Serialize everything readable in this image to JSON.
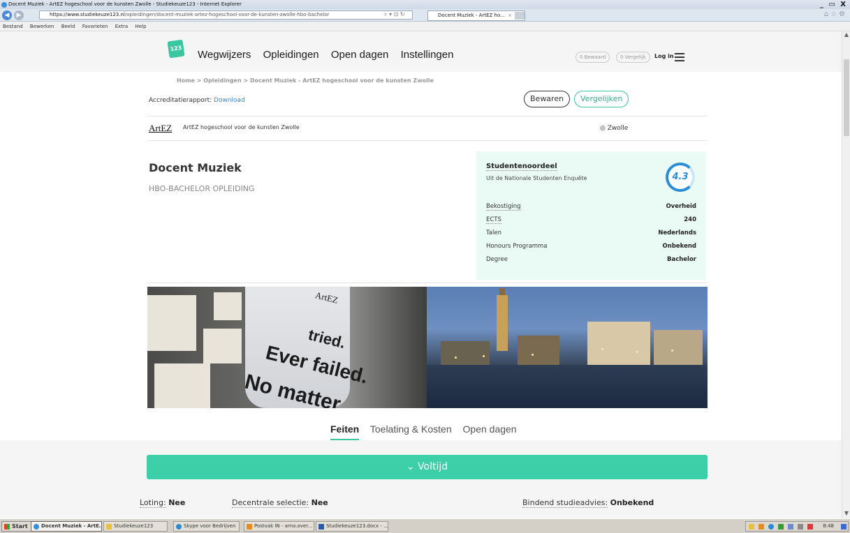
{
  "window": {
    "title": "Docent Muziek - ArtEZ hogeschool voor de kunsten Zwolle - Studiekeuze123 - Internet Explorer",
    "controls": "_ ▭ X"
  },
  "browser": {
    "url_host": "https://www.studiekeuze123.nl",
    "url_path": "/opleidingen/docent-muziek-artez-hogeschool-voor-de-kunsten-zwolle-hbo-bachelor",
    "tab_label": "Docent Muziek - ArtEZ ho...",
    "menu": [
      "Bestand",
      "Bewerken",
      "Beeld",
      "Favorieten",
      "Extra",
      "Help"
    ]
  },
  "site": {
    "logo_text": "123",
    "nav": [
      "Wegwijzers",
      "Opleidingen",
      "Open dagen",
      "Instellingen"
    ],
    "saved_pill": "0 Bewaard",
    "compare_pill": "0 Vergelijk",
    "login": "Log in"
  },
  "breadcrumb": "Home > Opleidingen > Docent Muziek - ArtEZ hogeschool voor de kunsten Zwolle",
  "accreditation": {
    "label": "Accreditatierapport:",
    "link": "Download"
  },
  "actions": {
    "save": "Bewaren",
    "compare": "Vergelijken"
  },
  "institution": {
    "logo": "ArtEZ",
    "name": "ArtEZ hogeschool voor de kunsten Zwolle",
    "location": "Zwolle"
  },
  "program": {
    "title": "Docent Muziek",
    "subtitle": "HBO-BACHELOR OPLEIDING"
  },
  "facts": {
    "rating_title": "Studentenoordeel",
    "rating_sub": "Uit de Nationale Studenten Enquête",
    "rating_value": "4.3",
    "rows": [
      {
        "key": "Bekostiging",
        "value": "Overheid"
      },
      {
        "key": "ECTS",
        "value": "240"
      },
      {
        "key": "Talen",
        "value": "Nederlands"
      },
      {
        "key": "Honours Programma",
        "value": "Onbekend"
      },
      {
        "key": "Degree",
        "value": "Bachelor"
      }
    ]
  },
  "hero_text": {
    "line1": "tried.",
    "line2": "Ever failed.",
    "line3": "No matter",
    "bag_logo": "ArtEZ"
  },
  "tabs": [
    "Feiten",
    "Toelating & Kosten",
    "Open dagen"
  ],
  "voltijd": "Voltijd",
  "fact_line": [
    {
      "key": "Loting:",
      "value": "Nee"
    },
    {
      "key": "Decentrale selectie:",
      "value": "Nee"
    },
    {
      "key": "Bindend studieadvies:",
      "value": "Onbekend"
    }
  ],
  "taskbar": {
    "start": "Start",
    "tasks": [
      "Docent Muziek - ArtE...",
      "Studiekeuze123",
      "Skype voor Bedrijven",
      "Postvak IN - arno.over...",
      "Studiekeuze123.docx - ..."
    ],
    "clock": "8:48"
  },
  "colors": {
    "accent": "#3ac6a0",
    "link": "#3a86c8",
    "rating": "#2a8dd6"
  }
}
